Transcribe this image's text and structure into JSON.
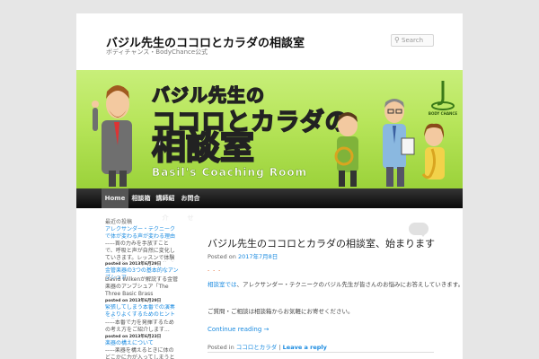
{
  "header": {
    "site_title": "バジル先生のココロとカラダの相談室",
    "site_description": "ボディチャンス・BodyChance公式",
    "search_placeholder": "Search"
  },
  "banner": {
    "line1": "バジル先生の",
    "line2": "ココロとカラダの",
    "line3": "相談室",
    "line4": "Basil's Coaching Room",
    "logo_text": "BODY CHANCE"
  },
  "nav": {
    "items": [
      "Home",
      "相談箱",
      "講師紹介",
      "お問合せ"
    ]
  },
  "sidebar": {
    "title": "最近の投稿",
    "entries": [
      {
        "link": "アレクサンダー・テクニークで体が変わる声が変わる理由",
        "excerpt": "-----首の力みを手放すことで、呼吸と声が自然に変化していきます。レッスンで体験した生徒さんの感想をご紹介します。",
        "date": "posted on 2013年6月29日"
      },
      {
        "link": "金管楽器の3つの基本的なアンブシュア",
        "excerpt": "David Wilkenが解説する金管楽器のアンブシュア「The Three Basic Brass Embouch...",
        "date": "posted on 2013年6月29日"
      },
      {
        "link": "緊張してしまう本番での演奏をよりよくするためのヒントを教えてください",
        "excerpt": "-----本番で力を発揮するための考え方をご紹介します...",
        "date": "posted on 2013年6月23日"
      },
      {
        "link": "楽器の構えについて",
        "excerpt": "-----楽器を構えるときに体のどこかに力が入ってしまうというご相談をいただきました。",
        "date": ""
      }
    ]
  },
  "post": {
    "title": "バジル先生のココロとカラダの相談室、始まります",
    "posted_on_label": "Posted on",
    "posted_date": "2017年7月8日",
    "dash": "- - -",
    "link_text": "相談室では",
    "paragraph1": "、アレクサンダー・テクニークのバジル先生が皆さんのお悩みにお答えしていきます。",
    "paragraph2": "ご質問・ご相談は相談箱からお気軽にお寄せください。",
    "continue_label": "Continue reading →",
    "posted_in_label": "Posted in",
    "category": "ココロとカラダ",
    "separator": "|",
    "leave_reply": "Leave a reply"
  },
  "colors": {
    "link": "#1b8be0",
    "banner_green": "#b7e55a",
    "nav_bg": "#0a0a0a"
  }
}
